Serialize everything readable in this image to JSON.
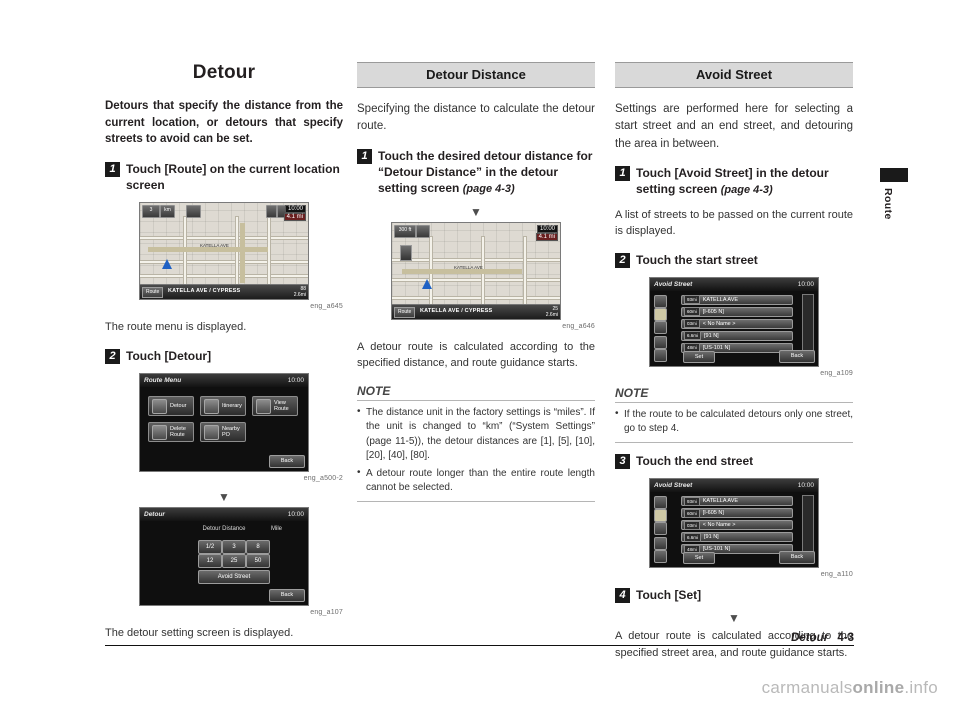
{
  "footer": {
    "title": "Detour",
    "page": "4-3"
  },
  "side_tab": {
    "label": "Route"
  },
  "watermark": {
    "text_light": "carmanuals",
    "text_bold": "online",
    "suffix": ".info"
  },
  "col1": {
    "title": "Detour",
    "lead": "Detours that specify the distance from the current location, or detours that specify streets to avoid can be set.",
    "step1": {
      "num": "1",
      "text": "Touch [Route] on the current location screen"
    },
    "fig1_caption": "eng_a645",
    "after_fig1": "The route menu is displayed.",
    "step2": {
      "num": "2",
      "text": "Touch [Detour]"
    },
    "fig2_caption": "eng_a500-2",
    "fig3_caption": "eng_a107",
    "after_fig3": "The detour setting screen is displayed.",
    "map_screen": {
      "clock": "10:00",
      "dist_badge": "4.1 mi",
      "bottom_btn": "Route",
      "street": "KATELLA AVE / CYPRESS",
      "right_top": "88",
      "right_btm": "2.6mi"
    },
    "menu_screen": {
      "title": "Route Menu",
      "clock": "10:00",
      "buttons": [
        "Detour",
        "Itinerary",
        "View Route",
        "Delete Route",
        "Nearby PO"
      ],
      "back": "Back"
    },
    "detour_screen": {
      "title": "Detour",
      "clock": "10:00",
      "label": "Detour Distance",
      "unit": "Mile",
      "row1": [
        "1/2",
        "3",
        "8"
      ],
      "row2": [
        "12",
        "25",
        "50"
      ],
      "wide_btn": "Avoid Street",
      "back": "Back"
    }
  },
  "col2": {
    "section": "Detour Distance",
    "intro": "Specifying the distance to calculate the detour route.",
    "step1": {
      "num": "1",
      "text": "Touch the desired detour distance for “Detour Distance” in the detour setting screen",
      "ital": "(page 4-3)"
    },
    "fig_caption": "eng_a646",
    "after_fig": "A detour route is calculated according to the specified distance, and route guidance starts.",
    "note_title": "NOTE",
    "notes": [
      "The distance unit in the factory settings is “miles”. If the unit is changed to “km” (“System Settings” (page 11-5)), the detour distances are [1], [5], [10], [20], [40], [80].",
      "A detour route longer than the entire route length cannot be selected."
    ],
    "map_screen": {
      "clock": "10:00",
      "dist_badge": "4.1 mi",
      "left_badge": "300 ft",
      "bottom_btn": "Route",
      "street": "KATELLA AVE / CYPRESS",
      "right_top": "25",
      "right_btm": "2.6mi"
    }
  },
  "col3": {
    "section": "Avoid Street",
    "intro": "Settings are performed here for selecting a start street and an end street, and detouring the area in between.",
    "step1": {
      "num": "1",
      "text": "Touch [Avoid Street] in the detour setting screen",
      "ital": "(page 4-3)"
    },
    "after_step1": "A list of streets to be passed on the current route is displayed.",
    "step2": {
      "num": "2",
      "text": "Touch the start street"
    },
    "fig1_caption": "eng_a109",
    "note_title": "NOTE",
    "notes": [
      "If the route to be calculated detours only one street, go to step 4."
    ],
    "step3": {
      "num": "3",
      "text": "Touch the end street"
    },
    "fig2_caption": "eng_a110",
    "step4": {
      "num": "4",
      "text": "Touch [Set]"
    },
    "after_step4": "A detour route is calculated according to the specified street area, and route guidance starts.",
    "avoid_screen": {
      "title": "Avoid Street",
      "clock": "10:00",
      "rows": [
        {
          "dist": "93mi",
          "name": "KATELLA AVE"
        },
        {
          "dist": "60mi",
          "name": "[I-605 N]"
        },
        {
          "dist": "03mi",
          "name": "< No Name >"
        },
        {
          "dist": "6.6mi",
          "name": "[91 N]"
        },
        {
          "dist": "48mi",
          "name": "[US-101 N]"
        }
      ],
      "set": "Set",
      "back": "Back"
    }
  }
}
